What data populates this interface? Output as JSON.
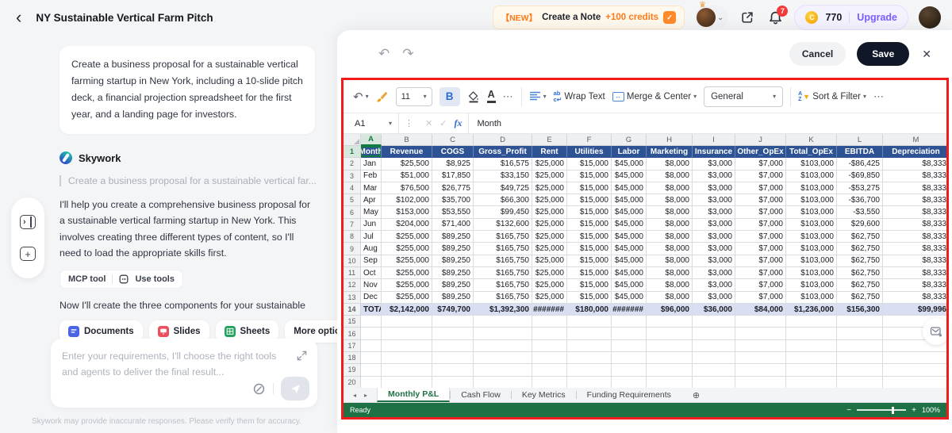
{
  "top_bar": {
    "title": "NY Sustainable Vertical Farm Pitch",
    "promo": {
      "badge": "【NEW】",
      "label": "Create a Note",
      "credits": "+100 credits"
    },
    "notification_count": "7",
    "credits": {
      "amount": "770",
      "upgrade_label": "Upgrade"
    }
  },
  "chat": {
    "user_message": "Create a business proposal for a sustainable vertical farming startup in New York, including a 10-slide pitch deck, a financial projection spreadsheet for the first year, and a landing page for investors.",
    "assistant_name": "Skywork",
    "quoted_prompt": "Create a business proposal for a sustainable vertical far...",
    "response_1": "I'll help you create a comprehensive business proposal for a sustainable vertical farming startup in New York. This involves creating three different types of content, so I'll need to load the appropriate skills first.",
    "tool_chip": {
      "left": "MCP tool",
      "right": "Use tools"
    },
    "response_2": "Now I'll create the three components for your sustainable",
    "actions": [
      {
        "label": "Documents"
      },
      {
        "label": "Slides"
      },
      {
        "label": "Sheets"
      },
      {
        "label": "More options"
      }
    ],
    "input_placeholder": "Enter your requirements, I'll choose the right tools and agents to deliver the final result...",
    "disclaimer": "Skywork may provide inaccurate responses. Please verify them for accuracy."
  },
  "editor": {
    "cancel_label": "Cancel",
    "save_label": "Save",
    "toolbar": {
      "font_size": "11",
      "bold_label": "B",
      "wrap_text": "Wrap Text",
      "merge_center": "Merge & Center",
      "number_format": "General",
      "sort_filter": "Sort & Filter"
    },
    "formula_bar": {
      "cell_ref": "A1",
      "fx_label": "fx",
      "value": "Month"
    },
    "sheet": {
      "column_letters": [
        "A",
        "B",
        "C",
        "D",
        "E",
        "F",
        "G",
        "H",
        "I",
        "J",
        "K",
        "L",
        "M"
      ],
      "header_row": [
        "Month",
        "Revenue",
        "COGS",
        "Gross_Profit",
        "Rent",
        "Utilities",
        "Labor",
        "Marketing",
        "Insurance",
        "Other_OpEx",
        "Total_OpEx",
        "EBITDA",
        "Depreciation"
      ],
      "rows": [
        [
          "Jan",
          "$25,500",
          "$8,925",
          "$16,575",
          "$25,000",
          "$15,000",
          "$45,000",
          "$8,000",
          "$3,000",
          "$7,000",
          "$103,000",
          "-$86,425",
          "$8,333"
        ],
        [
          "Feb",
          "$51,000",
          "$17,850",
          "$33,150",
          "$25,000",
          "$15,000",
          "$45,000",
          "$8,000",
          "$3,000",
          "$7,000",
          "$103,000",
          "-$69,850",
          "$8,333"
        ],
        [
          "Mar",
          "$76,500",
          "$26,775",
          "$49,725",
          "$25,000",
          "$15,000",
          "$45,000",
          "$8,000",
          "$3,000",
          "$7,000",
          "$103,000",
          "-$53,275",
          "$8,333"
        ],
        [
          "Apr",
          "$102,000",
          "$35,700",
          "$66,300",
          "$25,000",
          "$15,000",
          "$45,000",
          "$8,000",
          "$3,000",
          "$7,000",
          "$103,000",
          "-$36,700",
          "$8,333"
        ],
        [
          "May",
          "$153,000",
          "$53,550",
          "$99,450",
          "$25,000",
          "$15,000",
          "$45,000",
          "$8,000",
          "$3,000",
          "$7,000",
          "$103,000",
          "-$3,550",
          "$8,333"
        ],
        [
          "Jun",
          "$204,000",
          "$71,400",
          "$132,600",
          "$25,000",
          "$15,000",
          "$45,000",
          "$8,000",
          "$3,000",
          "$7,000",
          "$103,000",
          "$29,600",
          "$8,333"
        ],
        [
          "Jul",
          "$255,000",
          "$89,250",
          "$165,750",
          "$25,000",
          "$15,000",
          "$45,000",
          "$8,000",
          "$3,000",
          "$7,000",
          "$103,000",
          "$62,750",
          "$8,333"
        ],
        [
          "Aug",
          "$255,000",
          "$89,250",
          "$165,750",
          "$25,000",
          "$15,000",
          "$45,000",
          "$8,000",
          "$3,000",
          "$7,000",
          "$103,000",
          "$62,750",
          "$8,333"
        ],
        [
          "Sep",
          "$255,000",
          "$89,250",
          "$165,750",
          "$25,000",
          "$15,000",
          "$45,000",
          "$8,000",
          "$3,000",
          "$7,000",
          "$103,000",
          "$62,750",
          "$8,333"
        ],
        [
          "Oct",
          "$255,000",
          "$89,250",
          "$165,750",
          "$25,000",
          "$15,000",
          "$45,000",
          "$8,000",
          "$3,000",
          "$7,000",
          "$103,000",
          "$62,750",
          "$8,333"
        ],
        [
          "Nov",
          "$255,000",
          "$89,250",
          "$165,750",
          "$25,000",
          "$15,000",
          "$45,000",
          "$8,000",
          "$3,000",
          "$7,000",
          "$103,000",
          "$62,750",
          "$8,333"
        ],
        [
          "Dec",
          "$255,000",
          "$89,250",
          "$165,750",
          "$25,000",
          "$15,000",
          "$45,000",
          "$8,000",
          "$3,000",
          "$7,000",
          "$103,000",
          "$62,750",
          "$8,333"
        ]
      ],
      "total_row": [
        "TOTAL",
        "$2,142,000",
        "$749,700",
        "$1,392,300",
        "#######",
        "$180,000",
        "#######",
        "$96,000",
        "$36,000",
        "$84,000",
        "$1,236,000",
        "$156,300",
        "$99,996"
      ],
      "first_empty_row": 15,
      "last_empty_row": 20
    },
    "tabs": [
      {
        "label": "Monthly P&L",
        "active": true
      },
      {
        "label": "Cash Flow",
        "active": false
      },
      {
        "label": "Key Metrics",
        "active": false
      },
      {
        "label": "Funding Requirements",
        "active": false
      }
    ],
    "status": {
      "text": "Ready",
      "zoom": "100%"
    },
    "colors": {
      "header_blue": "#2E5395",
      "total_row_bg": "#D9DEF3",
      "excel_green": "#1E7145",
      "highlight_red": "#F21B1B",
      "accent_purple": "#7C5CFF",
      "accent_orange": "#FF7A1A"
    }
  }
}
